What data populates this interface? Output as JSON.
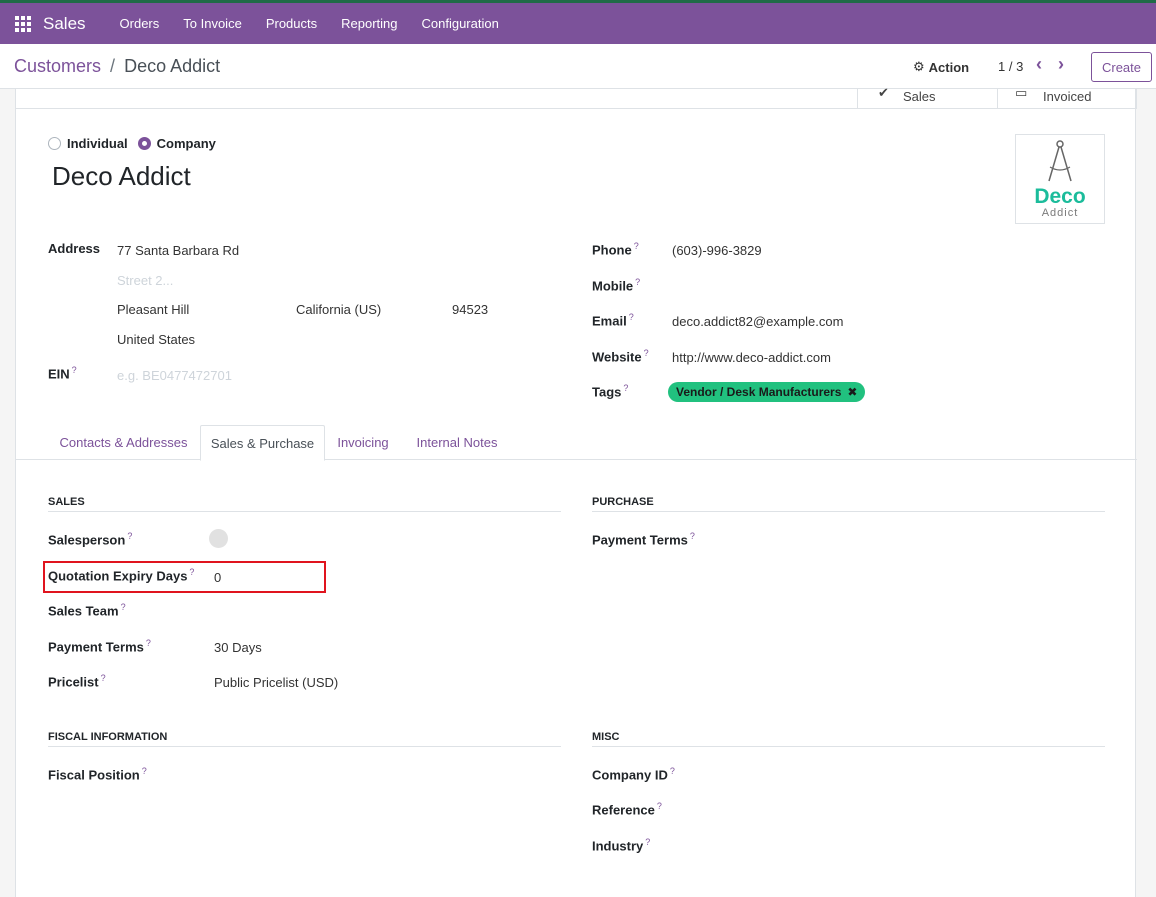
{
  "navbar": {
    "brand": "Sales",
    "menu": [
      "Orders",
      "To Invoice",
      "Products",
      "Reporting",
      "Configuration"
    ]
  },
  "breadcrumb": {
    "parent": "Customers",
    "separator": "/",
    "current": "Deco Addict"
  },
  "controls": {
    "action_label": "Action",
    "pager": "1 / 3",
    "create_label": "Create"
  },
  "smart_buttons": [
    {
      "label": "Sales",
      "icon": "dollar-icon"
    },
    {
      "label": "Invoiced",
      "icon": "invoice-icon"
    }
  ],
  "company_type": {
    "individual_label": "Individual",
    "company_label": "Company",
    "selected": "Company"
  },
  "partner": {
    "name": "Deco Addict",
    "logo_text_1": "Deco",
    "logo_text_2": "Addict"
  },
  "address": {
    "label": "Address",
    "street": "77 Santa Barbara Rd",
    "street2_placeholder": "Street 2...",
    "city": "Pleasant Hill",
    "state": "California (US)",
    "zip": "94523",
    "country": "United States"
  },
  "ein": {
    "label": "EIN",
    "placeholder": "e.g. BE0477472701"
  },
  "contact": {
    "phone_label": "Phone",
    "phone": "(603)-996-3829",
    "mobile_label": "Mobile",
    "email_label": "Email",
    "email": "deco.addict82@example.com",
    "website_label": "Website",
    "website": "http://www.deco-addict.com",
    "tags_label": "Tags",
    "tags": [
      "Vendor / Desk Manufacturers"
    ]
  },
  "help_mark": "?",
  "tabs": [
    "Contacts & Addresses",
    "Sales & Purchase",
    "Invoicing",
    "Internal Notes"
  ],
  "active_tab": "Sales & Purchase",
  "sales": {
    "title": "SALES",
    "salesperson_label": "Salesperson",
    "quotation_expiry_label": "Quotation Expiry Days",
    "quotation_expiry_value": "0",
    "sales_team_label": "Sales Team",
    "payment_terms_label": "Payment Terms",
    "payment_terms_value": "30 Days",
    "pricelist_label": "Pricelist",
    "pricelist_value": "Public Pricelist (USD)"
  },
  "purchase": {
    "title": "PURCHASE",
    "payment_terms_label": "Payment Terms"
  },
  "fiscal": {
    "title": "FISCAL INFORMATION",
    "fiscal_position_label": "Fiscal Position"
  },
  "misc": {
    "title": "MISC",
    "company_id_label": "Company ID",
    "reference_label": "Reference",
    "industry_label": "Industry"
  },
  "colors": {
    "primary": "#7c529a",
    "tag": "#21c17f",
    "highlight": "#e0141e"
  }
}
